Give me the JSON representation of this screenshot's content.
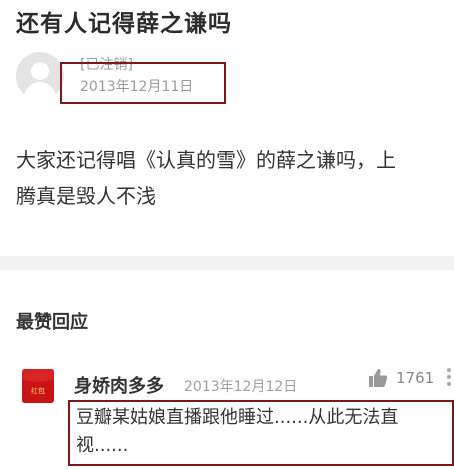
{
  "post": {
    "title": "还有人记得薛之谦吗",
    "author": "[已注销]",
    "date": "2013年12月11日",
    "body_line1": "大家还记得唱《认真的雪》的薛之谦吗，上",
    "body_line2": "腾真是毁人不浅"
  },
  "comments_section": {
    "heading": "最赞回应"
  },
  "comment": {
    "user": "身娇肉多多",
    "date": "2013年12月12日",
    "likes": "1761",
    "text": "豆瓣某姑娘直播跟他睡过......从此无法直视......",
    "avatar_text": "红包"
  },
  "colors": {
    "highlight_border": "#7a1a1a",
    "avatar_red": "#c81414",
    "muted_text": "#9a9a9a",
    "divider": "#f2f2f2"
  },
  "icons": {
    "like": "thumbs-up-icon",
    "more": "more-dots-icon",
    "avatar": "default-user-icon"
  }
}
